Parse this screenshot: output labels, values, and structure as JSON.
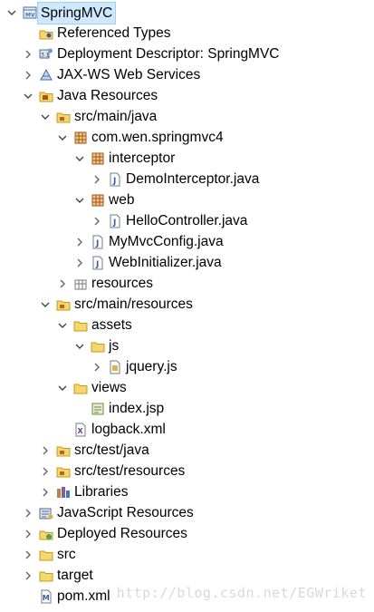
{
  "tree": {
    "root": "SpringMVC",
    "referenced_types": "Referenced Types",
    "deployment_descriptor": "Deployment Descriptor: SpringMVC",
    "jax_ws": "JAX-WS Web Services",
    "java_resources": "Java Resources",
    "src_main_java": "src/main/java",
    "pkg_root": "com.wen.springmvc4",
    "pkg_interceptor": "interceptor",
    "demo_interceptor": "DemoInterceptor.java",
    "pkg_web": "web",
    "hello_controller": "HelloController.java",
    "my_mvc_config": "MyMvcConfig.java",
    "web_initializer": "WebInitializer.java",
    "resources": "resources",
    "src_main_resources": "src/main/resources",
    "assets": "assets",
    "js": "js",
    "jquery": "jquery.js",
    "views": "views",
    "index_jsp": "index.jsp",
    "logback": "logback.xml",
    "src_test_java": "src/test/java",
    "src_test_resources": "src/test/resources",
    "libraries": "Libraries",
    "javascript_resources": "JavaScript Resources",
    "deployed_resources": "Deployed Resources",
    "src": "src",
    "target": "target",
    "pom": "pom.xml"
  },
  "watermark": "http://blog.csdn.net/EGWriket",
  "colors": {
    "folder": "#e8c14f",
    "package": "#b5651d",
    "java_file": "#3a5d9c",
    "selection": "#cfe8fc"
  }
}
